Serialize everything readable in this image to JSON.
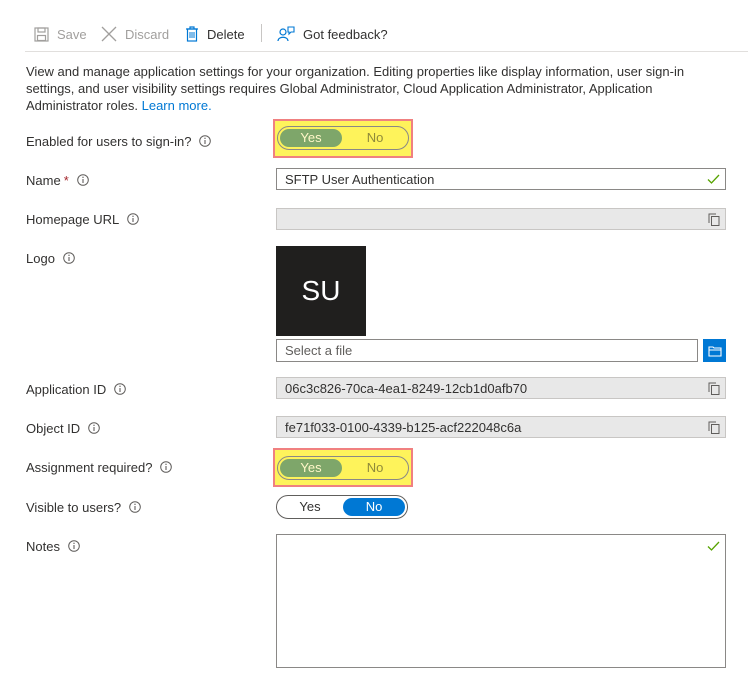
{
  "toolbar": {
    "save_label": "Save",
    "discard_label": "Discard",
    "delete_label": "Delete",
    "feedback_label": "Got feedback?"
  },
  "description": {
    "text": "View and manage application settings for your organization. Editing properties like display information, user sign-in settings, and user visibility settings requires Global Administrator, Cloud Application Administrator, Application Administrator roles.",
    "link": "Learn more."
  },
  "fields": {
    "enabled_signin": {
      "label": "Enabled for users to sign-in?",
      "yes": "Yes",
      "no": "No",
      "selected": "Yes"
    },
    "name": {
      "label": "Name",
      "required_mark": "*",
      "value": "SFTP User Authentication"
    },
    "homepage": {
      "label": "Homepage URL",
      "value": ""
    },
    "logo": {
      "label": "Logo",
      "initials": "SU",
      "file_placeholder": "Select a file"
    },
    "app_id": {
      "label": "Application ID",
      "value": "06c3c826-70ca-4ea1-8249-12cb1d0afb70"
    },
    "object_id": {
      "label": "Object ID",
      "value": "fe71f033-0100-4339-b125-acf222048c6a"
    },
    "assignment": {
      "label": "Assignment required?",
      "yes": "Yes",
      "no": "No",
      "selected": "Yes"
    },
    "visible": {
      "label": "Visible to users?",
      "yes": "Yes",
      "no": "No",
      "selected": "No"
    },
    "notes": {
      "label": "Notes",
      "value": ""
    }
  },
  "colors": {
    "accent": "#0078d4",
    "highlight": "#fef35b",
    "highlight_border": "#f08080",
    "valid_check": "#57a300"
  },
  "icons": {
    "save": "save-icon",
    "discard": "discard-x-icon",
    "delete": "trash-icon",
    "feedback": "feedback-person-icon",
    "info": "info-circle-icon",
    "copy": "copy-icon",
    "check": "check-icon",
    "browse": "folder-icon"
  }
}
